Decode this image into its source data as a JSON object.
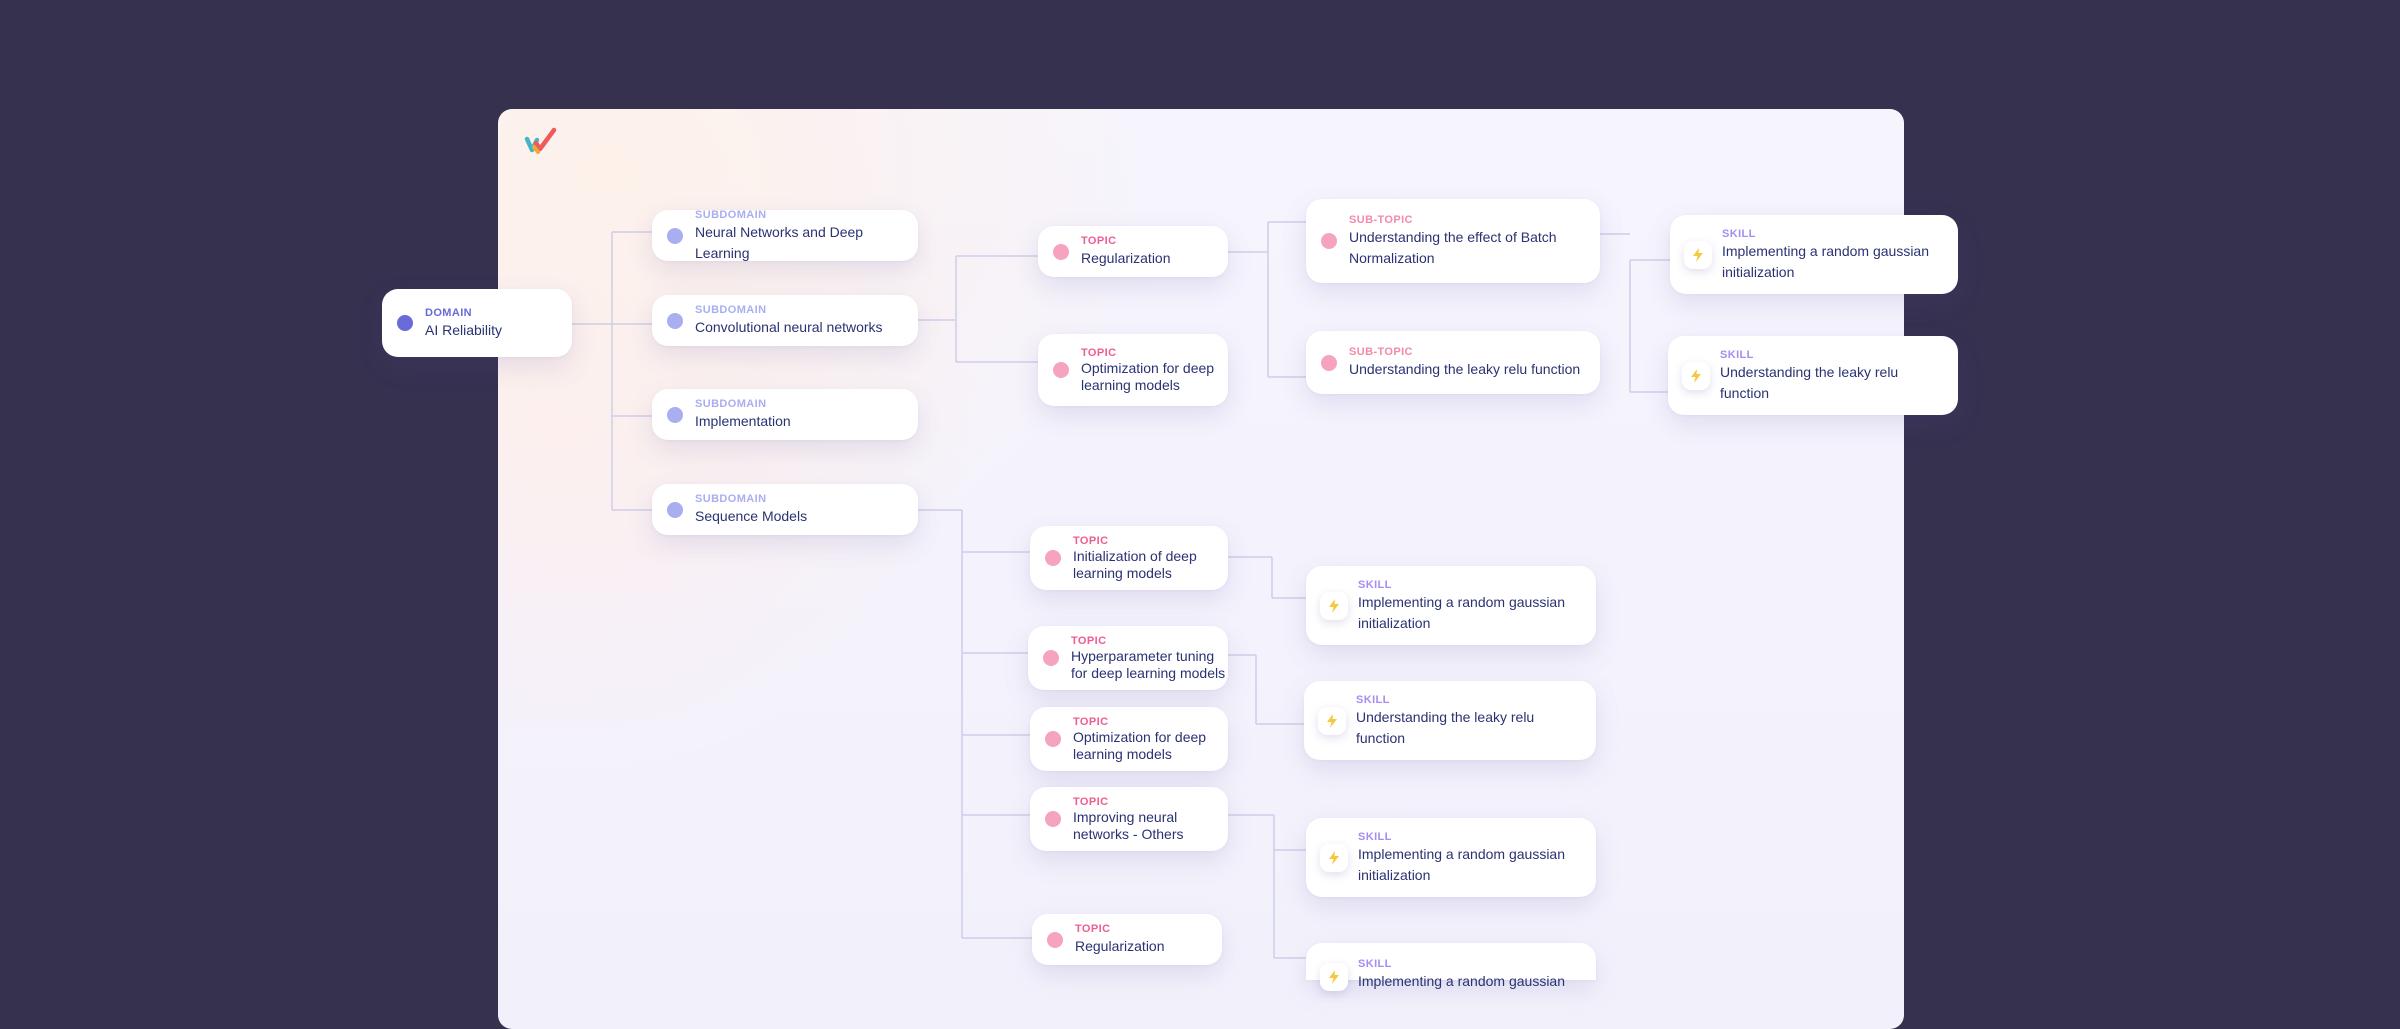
{
  "diagram": {
    "kinds": {
      "domain": "DOMAIN",
      "subdomain": "SUBDOMAIN",
      "topic": "TOPIC",
      "subtopic": "SUB-TOPIC",
      "skill": "SKILL"
    },
    "domain": {
      "label": "AI Reliability"
    },
    "subdomains": [
      {
        "label": "Neural Networks and Deep Learning"
      },
      {
        "label": "Convolutional neural networks"
      },
      {
        "label": "Implementation"
      },
      {
        "label": "Sequence Models"
      }
    ],
    "cnn_topics": [
      {
        "label": "Regularization"
      },
      {
        "label": "Optimization for deep learning models"
      }
    ],
    "subtopics": [
      {
        "label": "Understanding the effect of Batch Normalization"
      },
      {
        "label": "Understanding the leaky relu function"
      }
    ],
    "right_skills": [
      {
        "label": "Implementing a random gaussian initialization"
      },
      {
        "label": "Understanding the leaky relu function"
      }
    ],
    "seq_topics": [
      {
        "label": "Initialization of deep learning models"
      },
      {
        "label": "Hyperparameter tuning for deep learning models"
      },
      {
        "label": "Optimization for deep learning models"
      },
      {
        "label": "Improving neural networks - Others"
      },
      {
        "label": "Regularization"
      }
    ],
    "seq_skills": [
      {
        "label": "Implementing a random gaussian initialization"
      },
      {
        "label": "Understanding the leaky relu function"
      },
      {
        "label": "Implementing a random gaussian initialization"
      },
      {
        "label": "Implementing a random gaussian"
      }
    ]
  },
  "colors": {
    "background": "#373150",
    "domain_accent": "#6a6ad9",
    "subdomain_accent": "#a9aef0",
    "topic_accent": "#ef5d90",
    "skill_accent": "#a68df0",
    "skill_icon": "#f5c842",
    "connector": "#cfcdea"
  },
  "icons": {
    "logo": "brand-logo",
    "skill": "lightning-icon"
  }
}
